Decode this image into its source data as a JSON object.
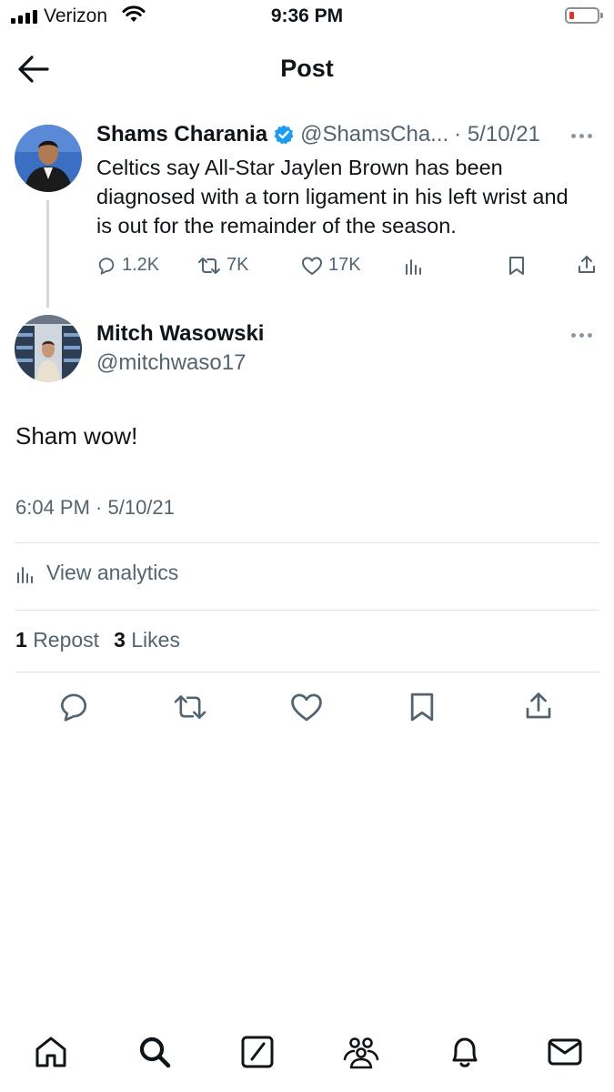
{
  "status_bar": {
    "carrier": "Verizon",
    "time": "9:36 PM"
  },
  "header": {
    "title": "Post"
  },
  "quoted_tweet": {
    "name": "Shams Charania",
    "handle": "@ShamsCha...",
    "date": "· 5/10/21",
    "text": "Celtics say All-Star Jaylen Brown has been diagnosed with a torn ligament in his left wrist and is out for the remainder of the season.",
    "replies": "1.2K",
    "reposts": "7K",
    "likes": "17K"
  },
  "reply": {
    "name": "Mitch Wasowski",
    "handle": "@mitchwaso17",
    "text": "Sham wow!",
    "timestamp": "6:04 PM · 5/10/21"
  },
  "analytics": {
    "label": "View analytics"
  },
  "stats": {
    "reposts_count": "1",
    "reposts_label": "Repost",
    "likes_count": "3",
    "likes_label": "Likes"
  },
  "colors": {
    "verified": "#1d9bf0",
    "secondary_text": "#536471",
    "divider": "#dfe3e6"
  },
  "icons": [
    "back-arrow-icon",
    "verified-badge-icon",
    "more-icon",
    "reply-icon",
    "repost-icon",
    "like-icon",
    "views-icon",
    "bookmark-icon",
    "share-icon",
    "home-icon",
    "search-icon",
    "compose-icon",
    "communities-icon",
    "notifications-icon",
    "messages-icon"
  ]
}
